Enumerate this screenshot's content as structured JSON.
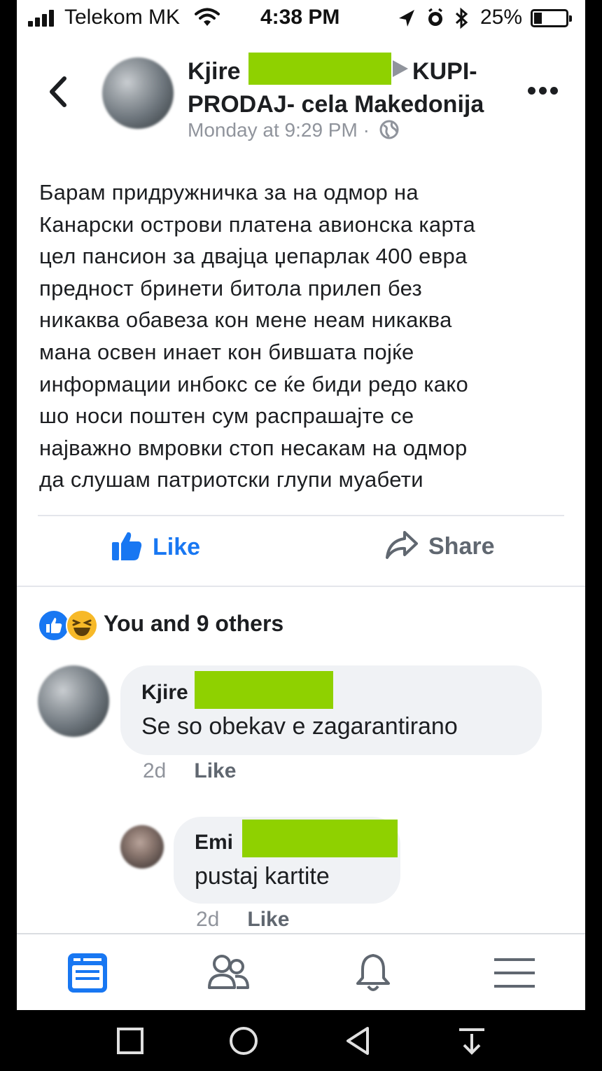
{
  "status_bar": {
    "carrier": "Telekom MK",
    "time": "4:38 PM",
    "battery": "25%",
    "battery_level_percent": 25
  },
  "post": {
    "author": "Kjire",
    "group": "KUPI-PRODAJ- cela Makedonija",
    "timestamp": "Monday at 9:29 PM",
    "separator": "·",
    "body_lines": [
      "Барам придружничка за на одмор на",
      "Канарски острови платена авионска карта",
      "цел пансион за двајца џепарлак 400 евра",
      "предност бринети битола прилеп без",
      "никаква обавеза кон мене неам никаква",
      "мана освен инает кон бившата појќе",
      "информации инбокс се ќе биди редо како",
      "шо носи поштен сум распрашајте се",
      "најважно вмровки стоп несакам на одмор",
      "да слушам патриотски глупи муабети"
    ]
  },
  "actions": {
    "like": "Like",
    "share": "Share"
  },
  "reactions": {
    "summary": "You and 9 others"
  },
  "comments": [
    {
      "author": "Kjire",
      "text": "Se so obekav e zagarantirano",
      "age": "2d",
      "like": "Like"
    },
    {
      "author": "Emi",
      "text": "pustaj kartite",
      "age": "2d",
      "like": "Like"
    }
  ],
  "tabbar": {
    "tabs": [
      "news-feed-icon",
      "friends-icon",
      "notifications-icon",
      "menu-icon"
    ],
    "active_color": "#1877f2"
  },
  "colors": {
    "redaction": "#8fd100",
    "facebook_blue": "#1877f2"
  }
}
